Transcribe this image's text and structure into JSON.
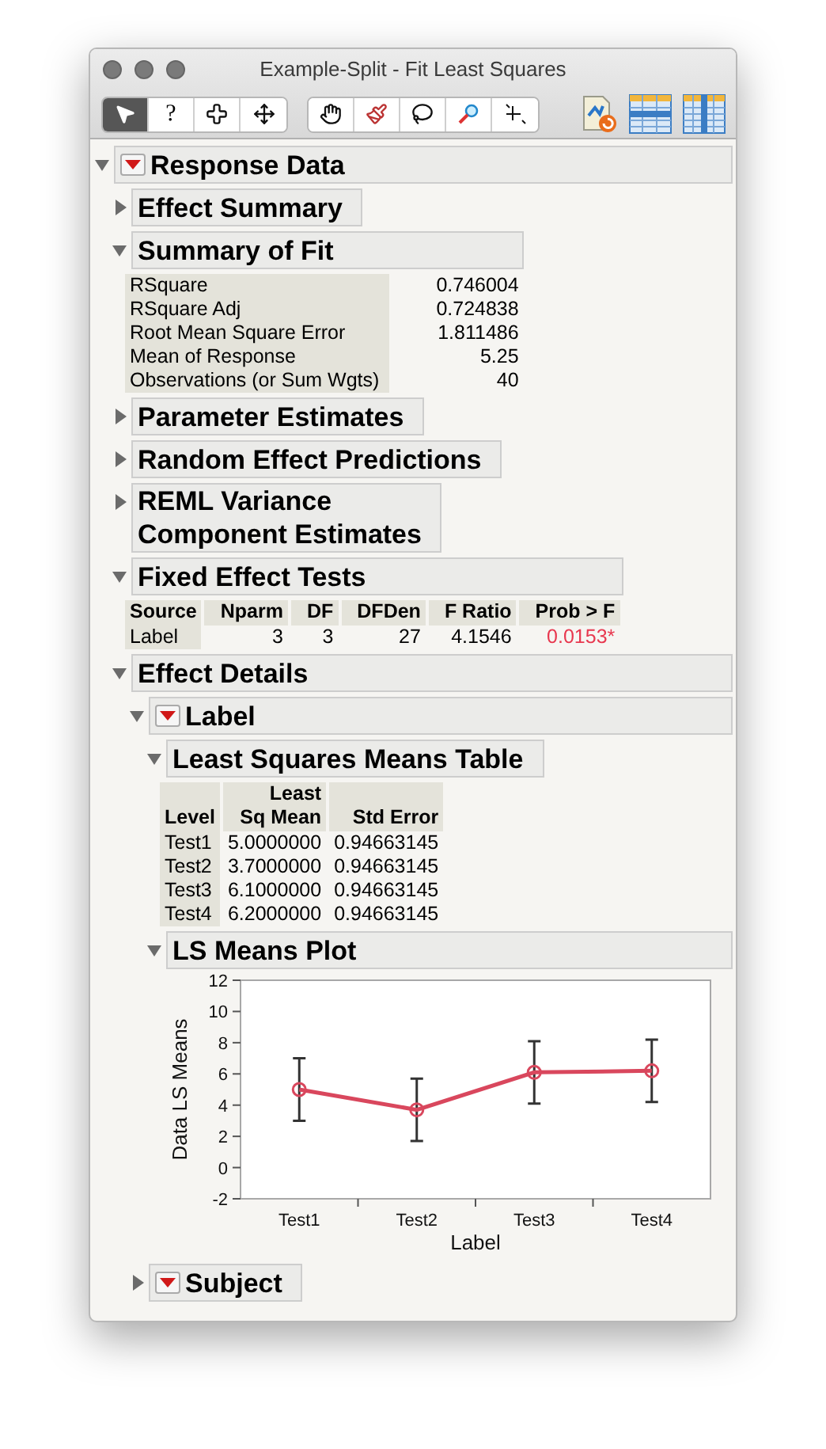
{
  "window": {
    "title": "Example-Split - Fit Least Squares"
  },
  "toolbar": {
    "groups": [
      [
        {
          "kind": "arrow",
          "selected": true
        },
        {
          "kind": "help",
          "label": "?",
          "selected": false
        },
        {
          "kind": "crosshair",
          "selected": false
        },
        {
          "kind": "move",
          "selected": false
        }
      ],
      [
        {
          "kind": "hand",
          "selected": false
        },
        {
          "kind": "brush",
          "selected": false
        },
        {
          "kind": "lasso",
          "selected": false
        },
        {
          "kind": "magnifier",
          "selected": false
        },
        {
          "kind": "scaler",
          "selected": false
        }
      ]
    ],
    "views": [
      {
        "kind": "script"
      },
      {
        "kind": "rows"
      },
      {
        "kind": "columns"
      }
    ]
  },
  "report": {
    "title": "Response Data",
    "expanded": true,
    "menu": true,
    "children": [
      {
        "title": "Effect Summary",
        "expanded": false,
        "menu": false
      },
      {
        "title": "Summary of Fit",
        "expanded": true,
        "menu": false,
        "summary": [
          {
            "label": "RSquare",
            "value": "0.746004"
          },
          {
            "label": "RSquare Adj",
            "value": "0.724838"
          },
          {
            "label": "Root Mean Square Error",
            "value": "1.811486"
          },
          {
            "label": "Mean of Response",
            "value": "5.25"
          },
          {
            "label": "Observations (or Sum Wgts)",
            "value": "40"
          }
        ]
      },
      {
        "title": "Parameter Estimates",
        "expanded": false,
        "menu": false
      },
      {
        "title": "Random Effect Predictions",
        "expanded": false,
        "menu": false
      },
      {
        "title": "REML Variance\nComponent Estimates",
        "expanded": false,
        "menu": false
      },
      {
        "title": "Fixed Effect Tests",
        "expanded": true,
        "menu": false,
        "table": {
          "columns": [
            "Source",
            "Nparm",
            "DF",
            "DFDen",
            "F Ratio",
            "Prob > F"
          ],
          "rows": [
            {
              "cells": [
                "Label",
                "3",
                "3",
                "27",
                "4.1546",
                "0.0153*"
              ],
              "significant": true
            }
          ]
        }
      },
      {
        "title": "Effect Details",
        "expanded": true,
        "menu": false,
        "children": [
          {
            "title": "Label",
            "expanded": true,
            "menu": true,
            "children": [
              {
                "title": "Least Squares Means Table",
                "expanded": true,
                "menu": false,
                "table": {
                  "columns": [
                    "Level",
                    "Least\nSq Mean",
                    "Std Error"
                  ],
                  "rows": [
                    {
                      "cells": [
                        "Test1",
                        "5.0000000",
                        "0.94663145"
                      ]
                    },
                    {
                      "cells": [
                        "Test2",
                        "3.7000000",
                        "0.94663145"
                      ]
                    },
                    {
                      "cells": [
                        "Test3",
                        "6.1000000",
                        "0.94663145"
                      ]
                    },
                    {
                      "cells": [
                        "Test4",
                        "6.2000000",
                        "0.94663145"
                      ]
                    }
                  ]
                }
              },
              {
                "title": "LS Means Plot",
                "expanded": true,
                "menu": false,
                "chart_data": {
                  "type": "line",
                  "xlabel": "Label",
                  "ylabel": "Data LS Means",
                  "categories": [
                    "Test1",
                    "Test2",
                    "Test3",
                    "Test4"
                  ],
                  "series": [
                    {
                      "color": "#d9475d",
                      "marker": "circle",
                      "values": [
                        5,
                        3.7,
                        6.1,
                        6.2
                      ],
                      "errors": [
                        2,
                        2,
                        2,
                        2
                      ]
                    }
                  ],
                  "ylim": [
                    -2,
                    12
                  ],
                  "yticks": [
                    -2,
                    0,
                    2,
                    4,
                    6,
                    8,
                    10,
                    12
                  ]
                }
              }
            ]
          },
          {
            "title": "Subject",
            "expanded": false,
            "menu": true
          }
        ]
      }
    ]
  }
}
